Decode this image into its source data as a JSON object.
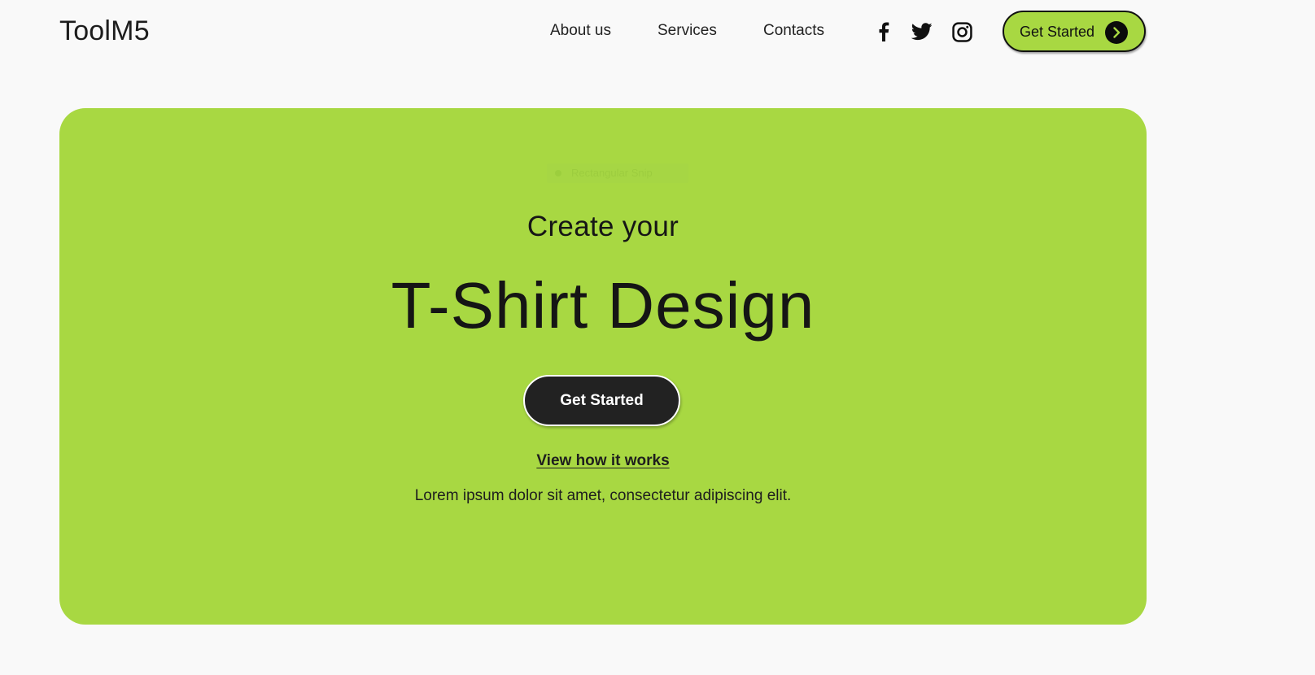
{
  "header": {
    "logo": "ToolM5",
    "nav": [
      {
        "label": "About us"
      },
      {
        "label": "Services"
      },
      {
        "label": "Contacts"
      }
    ],
    "social": [
      {
        "icon": "facebook-icon"
      },
      {
        "icon": "twitter-icon"
      },
      {
        "icon": "instagram-icon"
      }
    ],
    "cta": {
      "label": "Get Started",
      "icon": "chevron-right-icon"
    }
  },
  "overlay": {
    "label": "Rectangular Snip"
  },
  "hero": {
    "subtitle": "Create your",
    "title": "T-Shirt Design",
    "cta_label": "Get Started",
    "link_label": "View how it works",
    "description": "Lorem ipsum dolor sit amet, consectetur adipiscing elit."
  },
  "colors": {
    "accent": "#a8d842",
    "background": "#f9f9f9",
    "dark_button": "#222222",
    "text": "#1c1c1c"
  }
}
